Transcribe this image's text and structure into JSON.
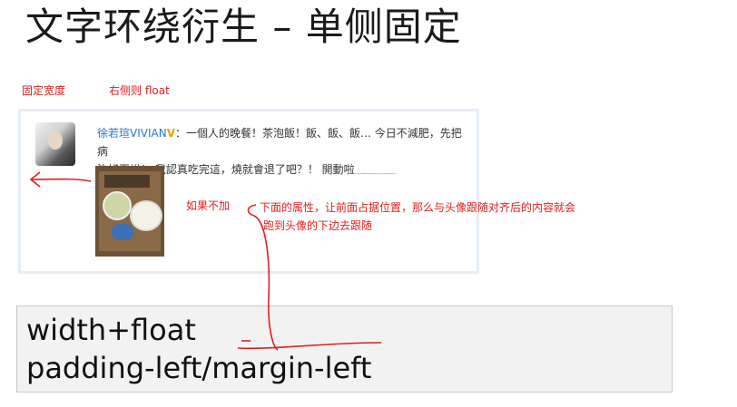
{
  "slide": {
    "title": "文字环绕衍生 – 单侧固定"
  },
  "notes": {
    "fixed_width": "固定宽度",
    "right_float": "右侧则 float",
    "if_not_added": "如果不加",
    "explanation_line1": "下面的属性，让前面占据位置，那么与头像跟随对齐后的内容就会",
    "explanation_line2": "跑到头像的下边去跟随"
  },
  "weibo_post": {
    "username": "徐若瑄VIVIAN",
    "badge": "V",
    "line1": "：一個人的晚餐！茶泡飯！飯、飯、飯… 今日不減肥，先把病",
    "line2": "治好再說！ 我認真吃完這，燒就會退了吧？！ 開動啦"
  },
  "code": {
    "line1": "width+float",
    "line2": "padding-left/margin-left"
  },
  "colors": {
    "annotation_red": "#e0201e",
    "username_blue": "#2a77c9",
    "card_border": "#e6edf4",
    "code_bg": "#f2f2f2"
  }
}
